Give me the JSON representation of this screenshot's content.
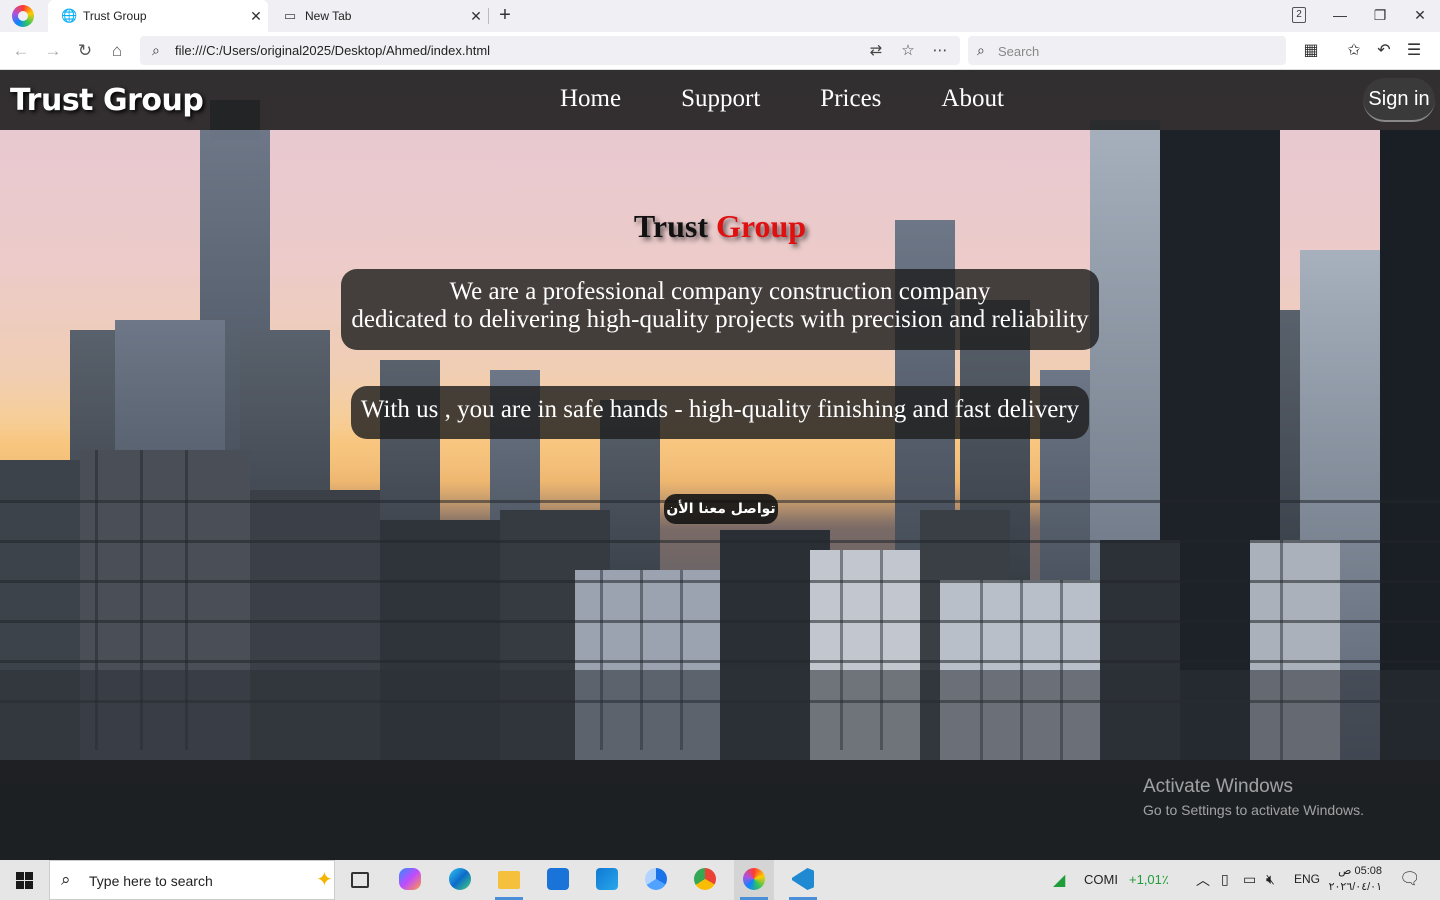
{
  "browser": {
    "tabs": [
      {
        "label": "Trust Group",
        "active": true
      },
      {
        "label": "New Tab",
        "active": false
      }
    ],
    "tab_count": "2",
    "url": "file:///C:/Users/original2025/Desktop/Ahmed/index.html",
    "search_placeholder": "Search"
  },
  "page": {
    "logo": "Trust Group",
    "nav": [
      "Home",
      "Support",
      "Prices",
      "About"
    ],
    "signin": "Sign in",
    "hero_title_main": "Trust",
    "hero_title_accent": "Group",
    "hero_line1": "We are a professional company construction company",
    "hero_line2": "dedicated to delivering high-quality projects with precision and reliability",
    "hero_line3": "With us , you are in safe hands - high-quality finishing and fast delivery",
    "cta": "تواصل معنا الأن"
  },
  "watermark": {
    "title": "Activate Windows",
    "subtitle": "Go to Settings to activate Windows."
  },
  "taskbar": {
    "search_placeholder": "Type here to search",
    "stock_name": "COMI",
    "stock_change": "+1,01٪",
    "language": "ENG",
    "time": "05:08 ص",
    "date": "٢٠٢٦/٠٤/٠١"
  },
  "colors": {
    "accent_red": "#e01010",
    "header_bg": "#191919",
    "stock_green": "#1f9d3a"
  }
}
